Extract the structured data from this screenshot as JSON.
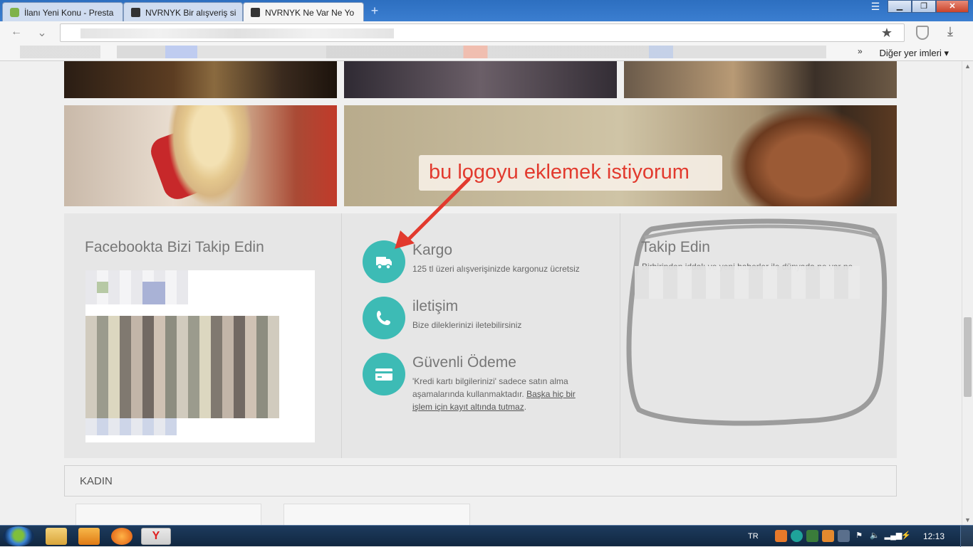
{
  "browser": {
    "tabs": [
      {
        "title": "İlanı Yeni Konu - Presta",
        "active": false
      },
      {
        "title": "NVRNYK Bir alışveriş si",
        "active": false
      },
      {
        "title": "NVRNYK Ne Var Ne Yo",
        "active": true
      }
    ],
    "new_tab": "+",
    "bookmarks_more": "Diğer yer imleri ▾",
    "bookmarks_chevron": "»"
  },
  "page": {
    "annotation": "bu logoyu eklemek istiyorum",
    "facebook_title": "Facebookta Bizi Takip Edin",
    "features": [
      {
        "title": "Kargo",
        "text": "125 tl üzeri alışverişinizde kargonuz ücretsiz",
        "icon": "truck-icon"
      },
      {
        "title": "iletişim",
        "text": "Bize dileklerinizi iletebilirsiniz",
        "icon": "phone-icon"
      },
      {
        "title": "Güvenli Ödeme",
        "text": "'Kredi kartı bilgilerinizi' sadece satın alma aşamalarında kullanmaktadır.",
        "link": "Başka hiç bir işlem için kayıt altında tutmaz",
        "suffix": ".",
        "icon": "credit-card-icon"
      }
    ],
    "social_title": "Takip Edin",
    "social_text": "Birbirinden iddalı ve yeni haberler ile dünyada ne var ne",
    "category_title": "KADIN"
  },
  "taskbar": {
    "language": "TR",
    "clock": "12:13",
    "yandex_label": "Y"
  },
  "colors": {
    "accent": "#3dbbb5",
    "annotation": "#e23a2e"
  }
}
